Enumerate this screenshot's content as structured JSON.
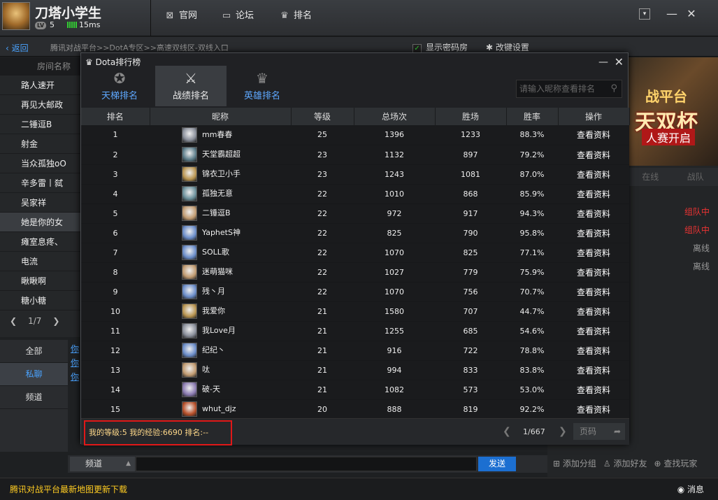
{
  "user": {
    "name": "刀塔小学生",
    "lv_badge": "LV",
    "level": "5",
    "ping": "15ms"
  },
  "topnav": {
    "official": "官网",
    "forum": "论坛",
    "rank": "排名"
  },
  "crumbbar": {
    "back": "返回",
    "path": "腾讯对战平台>>DotA专区>>高速双线区-双线入口",
    "show_pwd_room": "显示密码房",
    "key_settings": "改键设置"
  },
  "rooms": {
    "header": "房间名称",
    "items": [
      "路人速开",
      "再见大邮政",
      "二锤逗B",
      "射金",
      "当众孤独oO",
      "辛多雷丨弑",
      "吴家祥",
      "她是你的女",
      "瘫室息疼、",
      "电流",
      "瞅瞅啊",
      "糖小糖"
    ],
    "selected_index": 7,
    "page": "1/7"
  },
  "chat_tabs": {
    "all": "全部",
    "private": "私聊",
    "channel": "频道"
  },
  "chat_links": [
    "你",
    "你",
    "你"
  ],
  "input_bar": {
    "channel": "频道",
    "send": "发送"
  },
  "status_bar": {
    "news": "腾讯对战平台最新地图更新下载",
    "messages": "消息"
  },
  "right_panel": {
    "banner": {
      "line1": "战平台",
      "line2": "天双杯",
      "line3": "人赛开启"
    },
    "tabs": [
      "在线",
      "战队"
    ],
    "statuses": [
      {
        "text": "组队中",
        "color": "red"
      },
      {
        "text": "组队中",
        "color": "red"
      },
      {
        "text": "离线",
        "color": "gray"
      },
      {
        "text": "离线",
        "color": "gray"
      }
    ],
    "actions": {
      "add_group": "添加分组",
      "add_friend": "添加好友",
      "find_player": "查找玩家"
    }
  },
  "modal": {
    "title": "Dota排行榜",
    "tabs": [
      {
        "label": "天梯排名",
        "icon": "medal-icon"
      },
      {
        "label": "战绩排名",
        "icon": "crossed-swords-icon"
      },
      {
        "label": "英雄排名",
        "icon": "crown-icon"
      }
    ],
    "selected_tab": 1,
    "search_placeholder": "请输入昵称查看排名",
    "columns": [
      "排名",
      "昵称",
      "等级",
      "总场次",
      "胜场",
      "胜率",
      "操作"
    ],
    "rows": [
      {
        "rank": "1",
        "nick": "mm春春",
        "level": "25",
        "total": "1396",
        "wins": "1233",
        "rate": "88.3%",
        "action": "查看资料",
        "hero_color": "#8a8f9a"
      },
      {
        "rank": "2",
        "nick": "天堂霸超超",
        "level": "23",
        "total": "1132",
        "wins": "897",
        "rate": "79.2%",
        "action": "查看资料",
        "hero_color": "#5c7d8a"
      },
      {
        "rank": "3",
        "nick": "锦衣卫小手",
        "level": "23",
        "total": "1243",
        "wins": "1081",
        "rate": "87.0%",
        "action": "查看资料",
        "hero_color": "#b89450"
      },
      {
        "rank": "4",
        "nick": "孤独无意",
        "level": "22",
        "total": "1010",
        "wins": "868",
        "rate": "85.9%",
        "action": "查看资料",
        "hero_color": "#6a8f9a"
      },
      {
        "rank": "5",
        "nick": "二锤逗B",
        "level": "22",
        "total": "972",
        "wins": "917",
        "rate": "94.3%",
        "action": "查看资料",
        "hero_color": "#c09a70"
      },
      {
        "rank": "6",
        "nick": "YaphetS神",
        "level": "22",
        "total": "825",
        "wins": "790",
        "rate": "95.8%",
        "action": "查看资料",
        "hero_color": "#6a8cc8"
      },
      {
        "rank": "7",
        "nick": "SOLL歌",
        "level": "22",
        "total": "1070",
        "wins": "825",
        "rate": "77.1%",
        "action": "查看资料",
        "hero_color": "#6a8cc8"
      },
      {
        "rank": "8",
        "nick": "迷萌猫咪",
        "level": "22",
        "total": "1027",
        "wins": "779",
        "rate": "75.9%",
        "action": "查看资料",
        "hero_color": "#c09a70"
      },
      {
        "rank": "9",
        "nick": "残丶月",
        "level": "22",
        "total": "1070",
        "wins": "756",
        "rate": "70.7%",
        "action": "查看资料",
        "hero_color": "#6a8cc8"
      },
      {
        "rank": "10",
        "nick": "我爱你",
        "level": "21",
        "total": "1580",
        "wins": "707",
        "rate": "44.7%",
        "action": "查看资料",
        "hero_color": "#b89450"
      },
      {
        "rank": "11",
        "nick": "我Love月",
        "level": "21",
        "total": "1255",
        "wins": "685",
        "rate": "54.6%",
        "action": "查看资料",
        "hero_color": "#8a8f9a"
      },
      {
        "rank": "12",
        "nick": "纪纪丶",
        "level": "21",
        "total": "916",
        "wins": "722",
        "rate": "78.8%",
        "action": "查看资料",
        "hero_color": "#6a8cc8"
      },
      {
        "rank": "13",
        "nick": "呔",
        "level": "21",
        "total": "994",
        "wins": "833",
        "rate": "83.8%",
        "action": "查看资料",
        "hero_color": "#c09a70"
      },
      {
        "rank": "14",
        "nick": "破-天",
        "level": "21",
        "total": "1082",
        "wins": "573",
        "rate": "53.0%",
        "action": "查看资料",
        "hero_color": "#8a7ab0"
      },
      {
        "rank": "15",
        "nick": "whut_djz",
        "level": "20",
        "total": "888",
        "wins": "819",
        "rate": "92.2%",
        "action": "查看资料",
        "hero_color": "#b8502a"
      }
    ],
    "footer": {
      "my_info": "我的等级:5  我的经验:6690  排名:--",
      "page": "1/667",
      "page_input_placeholder": "页码"
    }
  }
}
